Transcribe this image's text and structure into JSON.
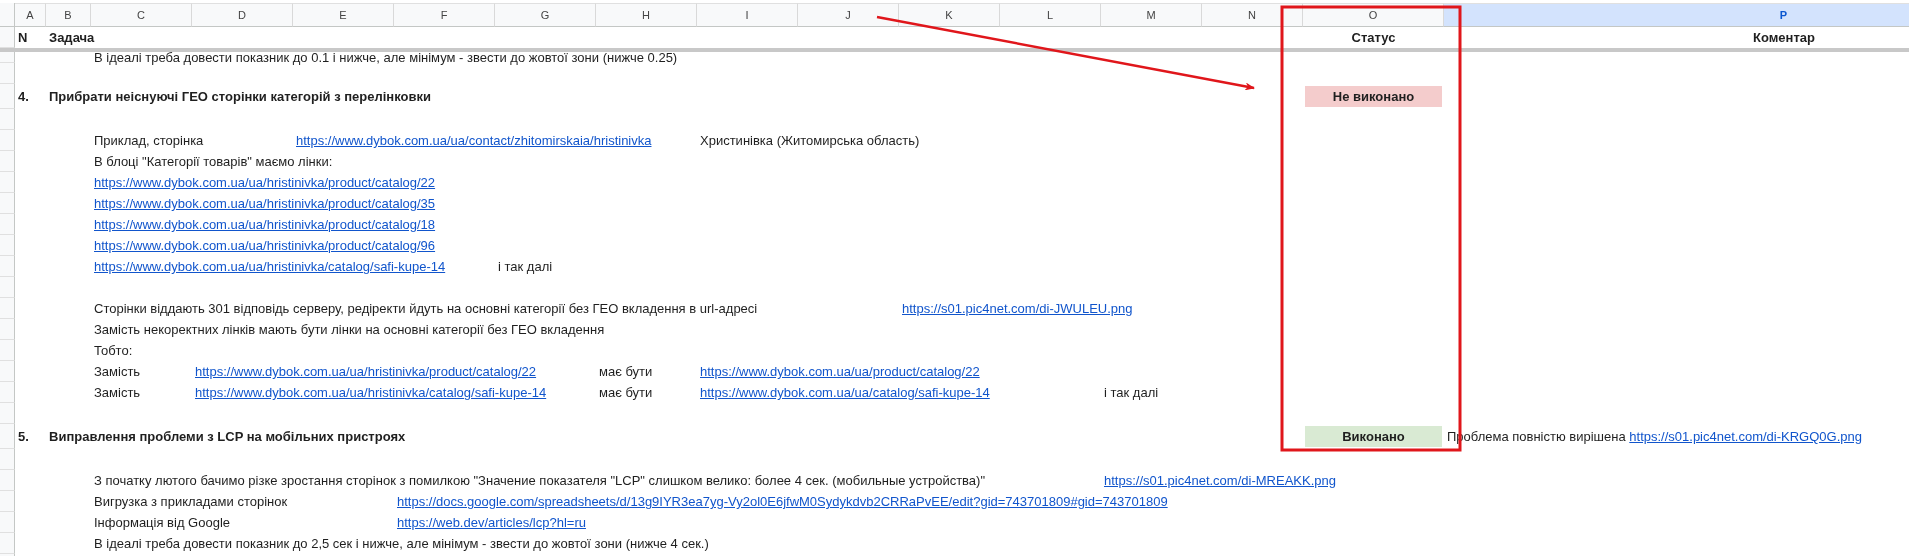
{
  "column_headers": [
    {
      "label": "A",
      "selected": false
    },
    {
      "label": "B",
      "selected": false
    },
    {
      "label": "C",
      "selected": false
    },
    {
      "label": "D",
      "selected": false
    },
    {
      "label": "E",
      "selected": false
    },
    {
      "label": "F",
      "selected": false
    },
    {
      "label": "G",
      "selected": false
    },
    {
      "label": "H",
      "selected": false
    },
    {
      "label": "I",
      "selected": false
    },
    {
      "label": "J",
      "selected": false
    },
    {
      "label": "K",
      "selected": false
    },
    {
      "label": "L",
      "selected": false
    },
    {
      "label": "M",
      "selected": false
    },
    {
      "label": "N",
      "selected": false
    },
    {
      "label": "O",
      "selected": false
    },
    {
      "label": "P",
      "selected": true
    }
  ],
  "header_row": {
    "n": "N",
    "task": "Задача",
    "status": "Статус",
    "comment": "Коментар"
  },
  "rows": [
    {
      "kind": "cut",
      "cells": {
        "C": {
          "kind": "text",
          "text": "В ідеалі треба довести показник до 0.1 і нижче, але мінімум - звести до жовтої зони (нижче 0.25)"
        }
      }
    },
    {
      "kind": "blank"
    },
    {
      "kind": "heading",
      "number": "4.",
      "title": "Прибрати неіснуючі ГЕО сторінки категорій з перелінковки",
      "status": {
        "text": "Не виконано",
        "kind": "not_done"
      }
    },
    {
      "kind": "blank"
    },
    {
      "kind": "text",
      "cells": {
        "C": {
          "kind": "text",
          "text": "Приклад, сторінка"
        },
        "E": {
          "kind": "link",
          "text": "https://www.dybok.com.ua/ua/contact/zhitomirskaia/hristinivka"
        },
        "I": {
          "kind": "text",
          "text": "Христинівка (Житомирська область)"
        }
      }
    },
    {
      "kind": "text",
      "cells": {
        "C": {
          "kind": "text",
          "text": "В блоці \"Категорії товарів\" маємо лінки:"
        }
      }
    },
    {
      "kind": "text",
      "cells": {
        "C": {
          "kind": "link",
          "text": "https://www.dybok.com.ua/ua/hristinivka/product/catalog/22"
        }
      }
    },
    {
      "kind": "text",
      "cells": {
        "C": {
          "kind": "link",
          "text": "https://www.dybok.com.ua/ua/hristinivka/product/catalog/35"
        }
      }
    },
    {
      "kind": "text",
      "cells": {
        "C": {
          "kind": "link",
          "text": "https://www.dybok.com.ua/ua/hristinivka/product/catalog/18"
        }
      }
    },
    {
      "kind": "text",
      "cells": {
        "C": {
          "kind": "link",
          "text": "https://www.dybok.com.ua/ua/hristinivka/product/catalog/96"
        }
      }
    },
    {
      "kind": "text",
      "cells": {
        "C": {
          "kind": "link",
          "text": "https://www.dybok.com.ua/ua/hristinivka/catalog/safi-kupe-14"
        },
        "G": {
          "kind": "text",
          "text": "і так далі"
        }
      }
    },
    {
      "kind": "blank"
    },
    {
      "kind": "text",
      "cells": {
        "C": {
          "kind": "text",
          "text": "Сторінки віддають 301 відповідь серверу, редіректи йдуть на основні категорії без ГЕО вкладення в url-адресі"
        },
        "K": {
          "kind": "link",
          "text": "https://s01.pic4net.com/di-JWULEU.png"
        }
      }
    },
    {
      "kind": "text",
      "cells": {
        "C": {
          "kind": "text",
          "text": "Замість некоректних лінків мають бути лінки на основні категорії без ГЕО вкладення"
        }
      }
    },
    {
      "kind": "text",
      "cells": {
        "C": {
          "kind": "text",
          "text": "Тобто:"
        }
      }
    },
    {
      "kind": "text",
      "cells": {
        "C": {
          "kind": "text",
          "text": "Замість"
        },
        "D": {
          "kind": "link",
          "text": "https://www.dybok.com.ua/ua/hristinivka/product/catalog/22"
        },
        "H": {
          "kind": "text",
          "text": "має бути"
        },
        "I": {
          "kind": "link",
          "text": "https://www.dybok.com.ua/ua/product/catalog/22"
        }
      }
    },
    {
      "kind": "text",
      "cells": {
        "C": {
          "kind": "text",
          "text": "Замість"
        },
        "D": {
          "kind": "link",
          "text": "https://www.dybok.com.ua/ua/hristinivka/catalog/safi-kupe-14"
        },
        "H": {
          "kind": "text",
          "text": "має бути"
        },
        "I": {
          "kind": "link",
          "text": "https://www.dybok.com.ua/ua/catalog/safi-kupe-14"
        },
        "M": {
          "kind": "text",
          "text": "і так далі"
        }
      }
    },
    {
      "kind": "blank"
    },
    {
      "kind": "heading",
      "number": "5.",
      "title": "Виправлення проблеми з LCP на мобільних пристроях",
      "status": {
        "text": "Виконано",
        "kind": "done"
      },
      "comment": {
        "text": "Проблема повністю вирішена",
        "link": "https://s01.pic4net.com/di-KRGQ0G.png"
      }
    },
    {
      "kind": "blank"
    },
    {
      "kind": "text",
      "cells": {
        "C": {
          "kind": "text",
          "text": "З початку лютого бачимо різке зростання сторінок з помилкою \"Значение показателя \"LCP\" слишком велико: более 4 сек. (мобильные устройства)\""
        },
        "M": {
          "kind": "link",
          "text": "https://s01.pic4net.com/di-MREAKK.png"
        }
      }
    },
    {
      "kind": "text",
      "cells": {
        "C": {
          "kind": "text",
          "text": "Вигрузка з прикладами сторінок"
        },
        "F": {
          "kind": "link",
          "text": "https://docs.google.com/spreadsheets/d/13g9IYR3ea7yg-Vy2ol0E6jfwM0Sydykdvb2CRRaPvEE/edit?gid=743701809#gid=743701809"
        }
      }
    },
    {
      "kind": "text",
      "cells": {
        "C": {
          "kind": "text",
          "text": "Інформація від Google"
        },
        "F": {
          "kind": "link",
          "text": "https://web.dev/articles/lcp?hl=ru"
        }
      }
    },
    {
      "kind": "text",
      "cells": {
        "C": {
          "kind": "text",
          "text": "В ідеалі треба довести показник до 2,5 сек і нижче, але мінімум - звести до жовтої зони (нижче 4 сек.)"
        }
      }
    },
    {
      "kind": "blank"
    }
  ]
}
